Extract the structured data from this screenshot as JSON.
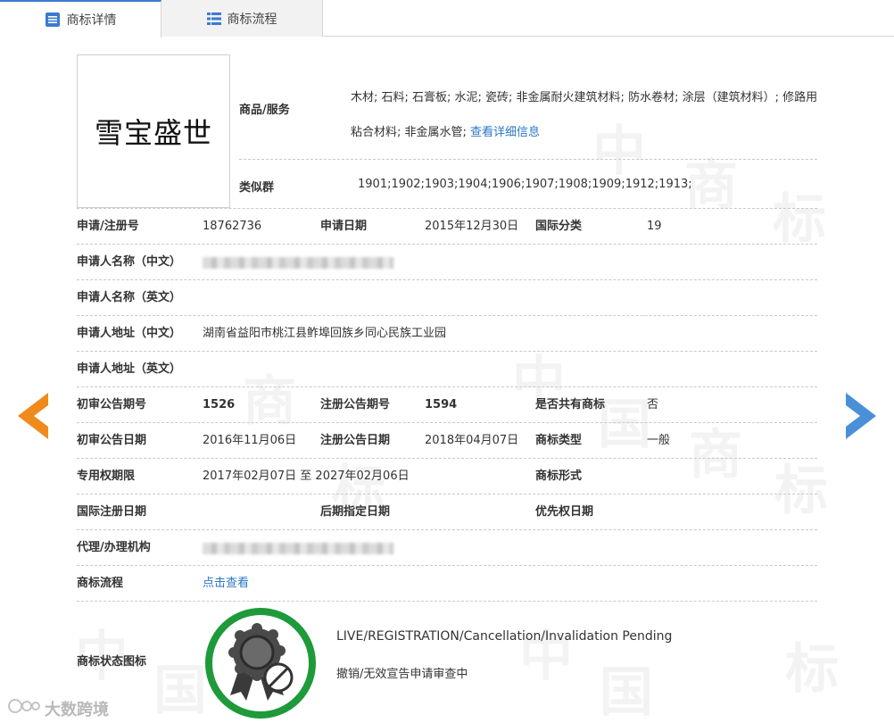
{
  "tabs": [
    {
      "label": "商标详情",
      "icon": "list-detail-icon"
    },
    {
      "label": "商标流程",
      "icon": "list-grid-icon"
    }
  ],
  "logo": {
    "text": "雪宝盛世"
  },
  "goods": {
    "label": "商品/服务",
    "value": "木材; 石料; 石膏板; 水泥; 瓷砖; 非金属耐火建筑材料; 防水卷材; 涂层（建筑材料）; 修路用粘合材料; 非金属水管;",
    "link": "查看详细信息"
  },
  "similar_group": {
    "label": "类似群",
    "value": "1901;1902;1903;1904;1906;1907;1908;1909;1912;1913;"
  },
  "rows": [
    {
      "l1": "申请/注册号",
      "v1": "18762736",
      "l2": "申请日期",
      "v2": "2015年12月30日",
      "l3": "国际分类",
      "v3": "19"
    },
    {
      "l1": "申请人名称（中文）",
      "v1": "",
      "l2": "",
      "v2": "",
      "l3": "",
      "v3": ""
    },
    {
      "l1": "申请人名称（英文）",
      "v1": "",
      "l2": "",
      "v2": "",
      "l3": "",
      "v3": ""
    },
    {
      "l1": "申请人地址（中文）",
      "v1": "湖南省益阳市桃江县鲊埠回族乡同心民族工业园",
      "l2": "",
      "v2": "",
      "l3": "",
      "v3": ""
    },
    {
      "l1": "申请人地址（英文）",
      "v1": "",
      "l2": "",
      "v2": "",
      "l3": "",
      "v3": ""
    },
    {
      "l1": "初审公告期号",
      "v1": "1526",
      "l2": "注册公告期号",
      "v2": "1594",
      "l3": "是否共有商标",
      "v3": "否"
    },
    {
      "l1": "初审公告日期",
      "v1": "2016年11月06日",
      "l2": "注册公告日期",
      "v2": "2018年04月07日",
      "l3": "商标类型",
      "v3": "一般"
    },
    {
      "l1": "专用权期限",
      "v1": "2017年02月07日 至 2027年02月06日",
      "l2": "",
      "v2": "",
      "l3": "商标形式",
      "v3": ""
    },
    {
      "l1": "国际注册日期",
      "v1": "",
      "l2": "后期指定日期",
      "v2": "",
      "l3": "优先权日期",
      "v3": ""
    },
    {
      "l1": "代理/办理机构",
      "v1": "",
      "l2": "",
      "v2": "",
      "l3": "",
      "v3": ""
    },
    {
      "l1": "商标流程",
      "v1": "点击查看",
      "l2": "",
      "v2": "",
      "l3": "",
      "v3": ""
    }
  ],
  "status": {
    "label": "商标状态图标",
    "en": "LIVE/REGISTRATION/Cancellation/Invalidation Pending",
    "cn": "撤销/无效宣告申请审查中",
    "ring_color": "#1e9a3a"
  },
  "watermark": {
    "chars": [
      "中",
      "国",
      "商",
      "标"
    ]
  },
  "brand": {
    "text": "大数跨境"
  },
  "colors": {
    "accent": "#3b7ad1",
    "arrow_left": "#f08a1c",
    "arrow_right": "#4a90d9",
    "link": "#2a77c4"
  }
}
